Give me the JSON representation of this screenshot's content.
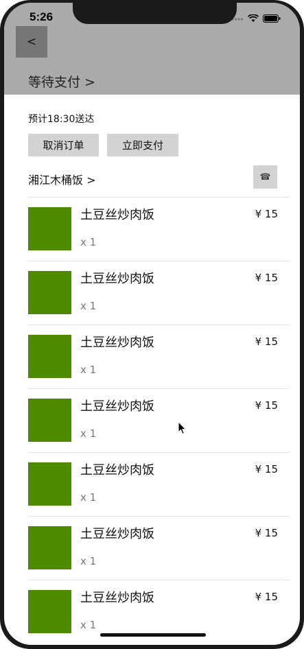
{
  "status_bar": {
    "time": "5:26"
  },
  "header": {
    "back_label": "<",
    "title": "等待支付 >"
  },
  "order": {
    "eta": "预计18:30送达",
    "cancel_label": "取消订单",
    "pay_label": "立即支付",
    "shop_name": "湘江木桶饭 >",
    "phone_icon": "☎"
  },
  "items": [
    {
      "name": "土豆丝炒肉饭",
      "price": "¥ 15",
      "qty": "x 1"
    },
    {
      "name": "土豆丝炒肉饭",
      "price": "¥ 15",
      "qty": "x 1"
    },
    {
      "name": "土豆丝炒肉饭",
      "price": "¥ 15",
      "qty": "x 1"
    },
    {
      "name": "土豆丝炒肉饭",
      "price": "¥ 15",
      "qty": "x 1"
    },
    {
      "name": "土豆丝炒肉饭",
      "price": "¥ 15",
      "qty": "x 1"
    },
    {
      "name": "土豆丝炒肉饭",
      "price": "¥ 15",
      "qty": "x 1"
    },
    {
      "name": "土豆丝炒肉饭",
      "price": "¥ 15",
      "qty": "x 1"
    }
  ],
  "colors": {
    "header_bg": "#aaaaaa",
    "thumb_green": "#4e8a00",
    "button_bg": "#d3d3d3"
  }
}
